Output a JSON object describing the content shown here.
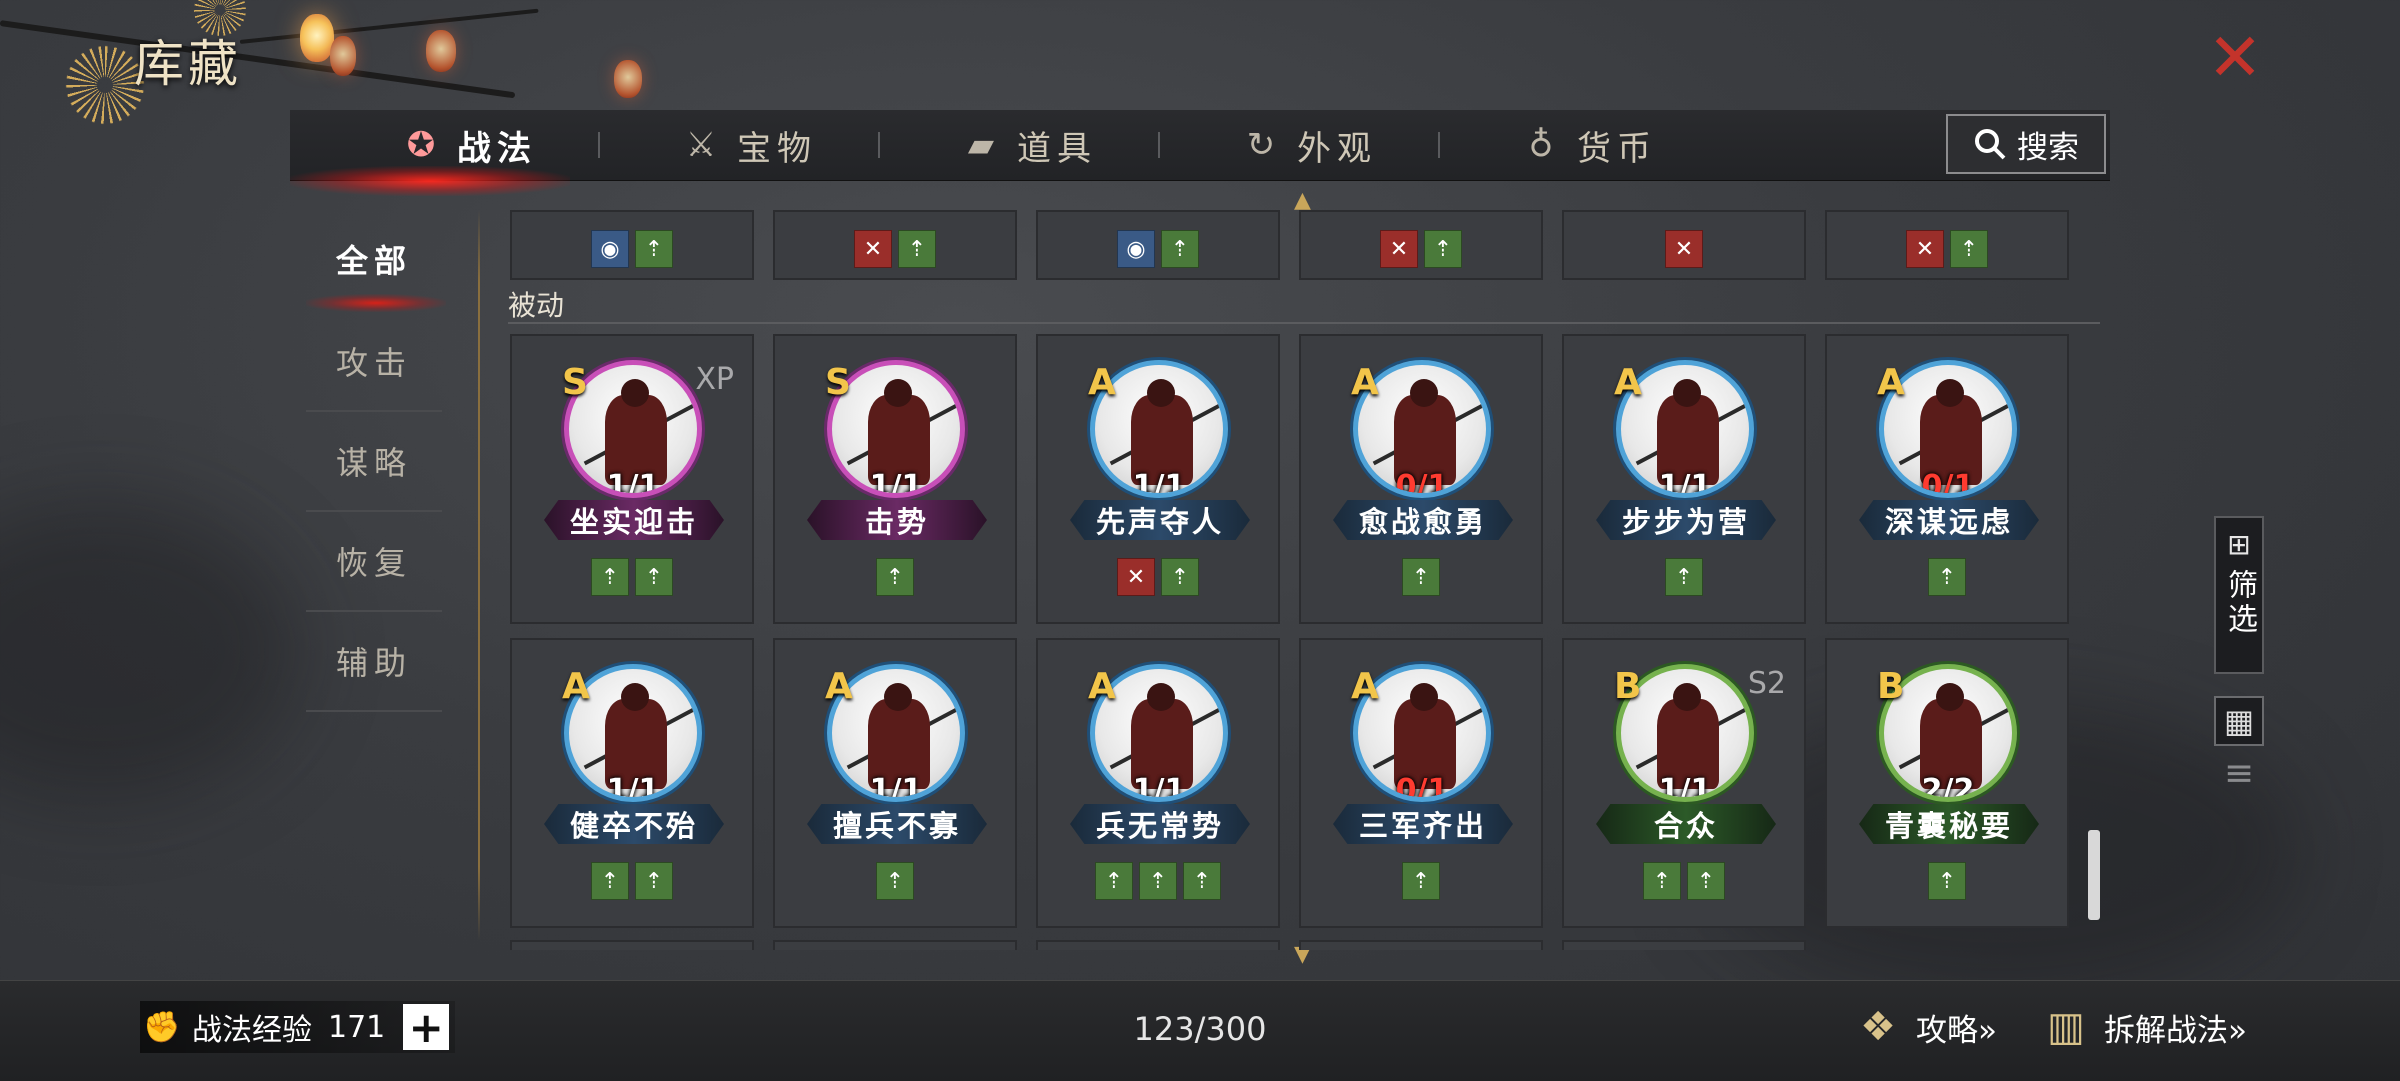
{
  "header": {
    "title": "库藏"
  },
  "tabs": [
    {
      "label": "战法",
      "icon": "scroll-icon",
      "active": true
    },
    {
      "label": "宝物",
      "icon": "treasure-icon",
      "active": false
    },
    {
      "label": "道具",
      "icon": "item-box-icon",
      "active": false
    },
    {
      "label": "外观",
      "icon": "appearance-icon",
      "active": false
    },
    {
      "label": "货币",
      "icon": "money-bag-icon",
      "active": false
    }
  ],
  "search": {
    "label": "搜索"
  },
  "categories": [
    {
      "label": "全部",
      "active": true
    },
    {
      "label": "攻击",
      "active": false
    },
    {
      "label": "谋略",
      "active": false
    },
    {
      "label": "恢复",
      "active": false
    },
    {
      "label": "辅助",
      "active": false
    }
  ],
  "top_row_icons": [
    [
      "blue",
      "green"
    ],
    [
      "red",
      "green"
    ],
    [
      "blue",
      "green"
    ],
    [
      "red",
      "green"
    ],
    [
      "red"
    ],
    [
      "red",
      "green"
    ]
  ],
  "section": {
    "label": "被动"
  },
  "cards": [
    {
      "grade": "S",
      "tag": "XP",
      "count": "1/1",
      "count_red": false,
      "name": "坐实迎击",
      "icons": [
        "green",
        "green"
      ]
    },
    {
      "grade": "S",
      "tag": "",
      "count": "1/1",
      "count_red": false,
      "name": "击势",
      "icons": [
        "green"
      ]
    },
    {
      "grade": "A",
      "tag": "",
      "count": "1/1",
      "count_red": false,
      "name": "先声夺人",
      "icons": [
        "red",
        "green"
      ]
    },
    {
      "grade": "A",
      "tag": "",
      "count": "0/1",
      "count_red": true,
      "name": "愈战愈勇",
      "icons": [
        "green"
      ]
    },
    {
      "grade": "A",
      "tag": "",
      "count": "1/1",
      "count_red": false,
      "name": "步步为营",
      "icons": [
        "green"
      ]
    },
    {
      "grade": "A",
      "tag": "",
      "count": "0/1",
      "count_red": true,
      "name": "深谋远虑",
      "icons": [
        "green"
      ]
    },
    {
      "grade": "A",
      "tag": "",
      "count": "1/1",
      "count_red": false,
      "name": "健卒不殆",
      "icons": [
        "green",
        "green"
      ]
    },
    {
      "grade": "A",
      "tag": "",
      "count": "1/1",
      "count_red": false,
      "name": "擅兵不寡",
      "icons": [
        "green"
      ]
    },
    {
      "grade": "A",
      "tag": "",
      "count": "1/1",
      "count_red": false,
      "name": "兵无常势",
      "icons": [
        "green",
        "green",
        "green"
      ]
    },
    {
      "grade": "A",
      "tag": "",
      "count": "0/1",
      "count_red": true,
      "name": "三军齐出",
      "icons": [
        "green"
      ]
    },
    {
      "grade": "B",
      "tag": "S2",
      "count": "1/1",
      "count_red": false,
      "name": "合众",
      "icons": [
        "green",
        "green"
      ]
    },
    {
      "grade": "B",
      "tag": "",
      "count": "2/2",
      "count_red": false,
      "name": "青囊秘要",
      "icons": [
        "green"
      ]
    }
  ],
  "filter": {
    "label": "筛选"
  },
  "bottom": {
    "exp_label": "战法经验",
    "exp_value": "171",
    "capacity": "123/300",
    "guide_label": "攻略»",
    "dismantle_label": "拆解战法»"
  },
  "colors": {
    "accent_red": "#c4332b",
    "grade_gold": "#f2c54a",
    "count_red": "#ff3b30"
  }
}
